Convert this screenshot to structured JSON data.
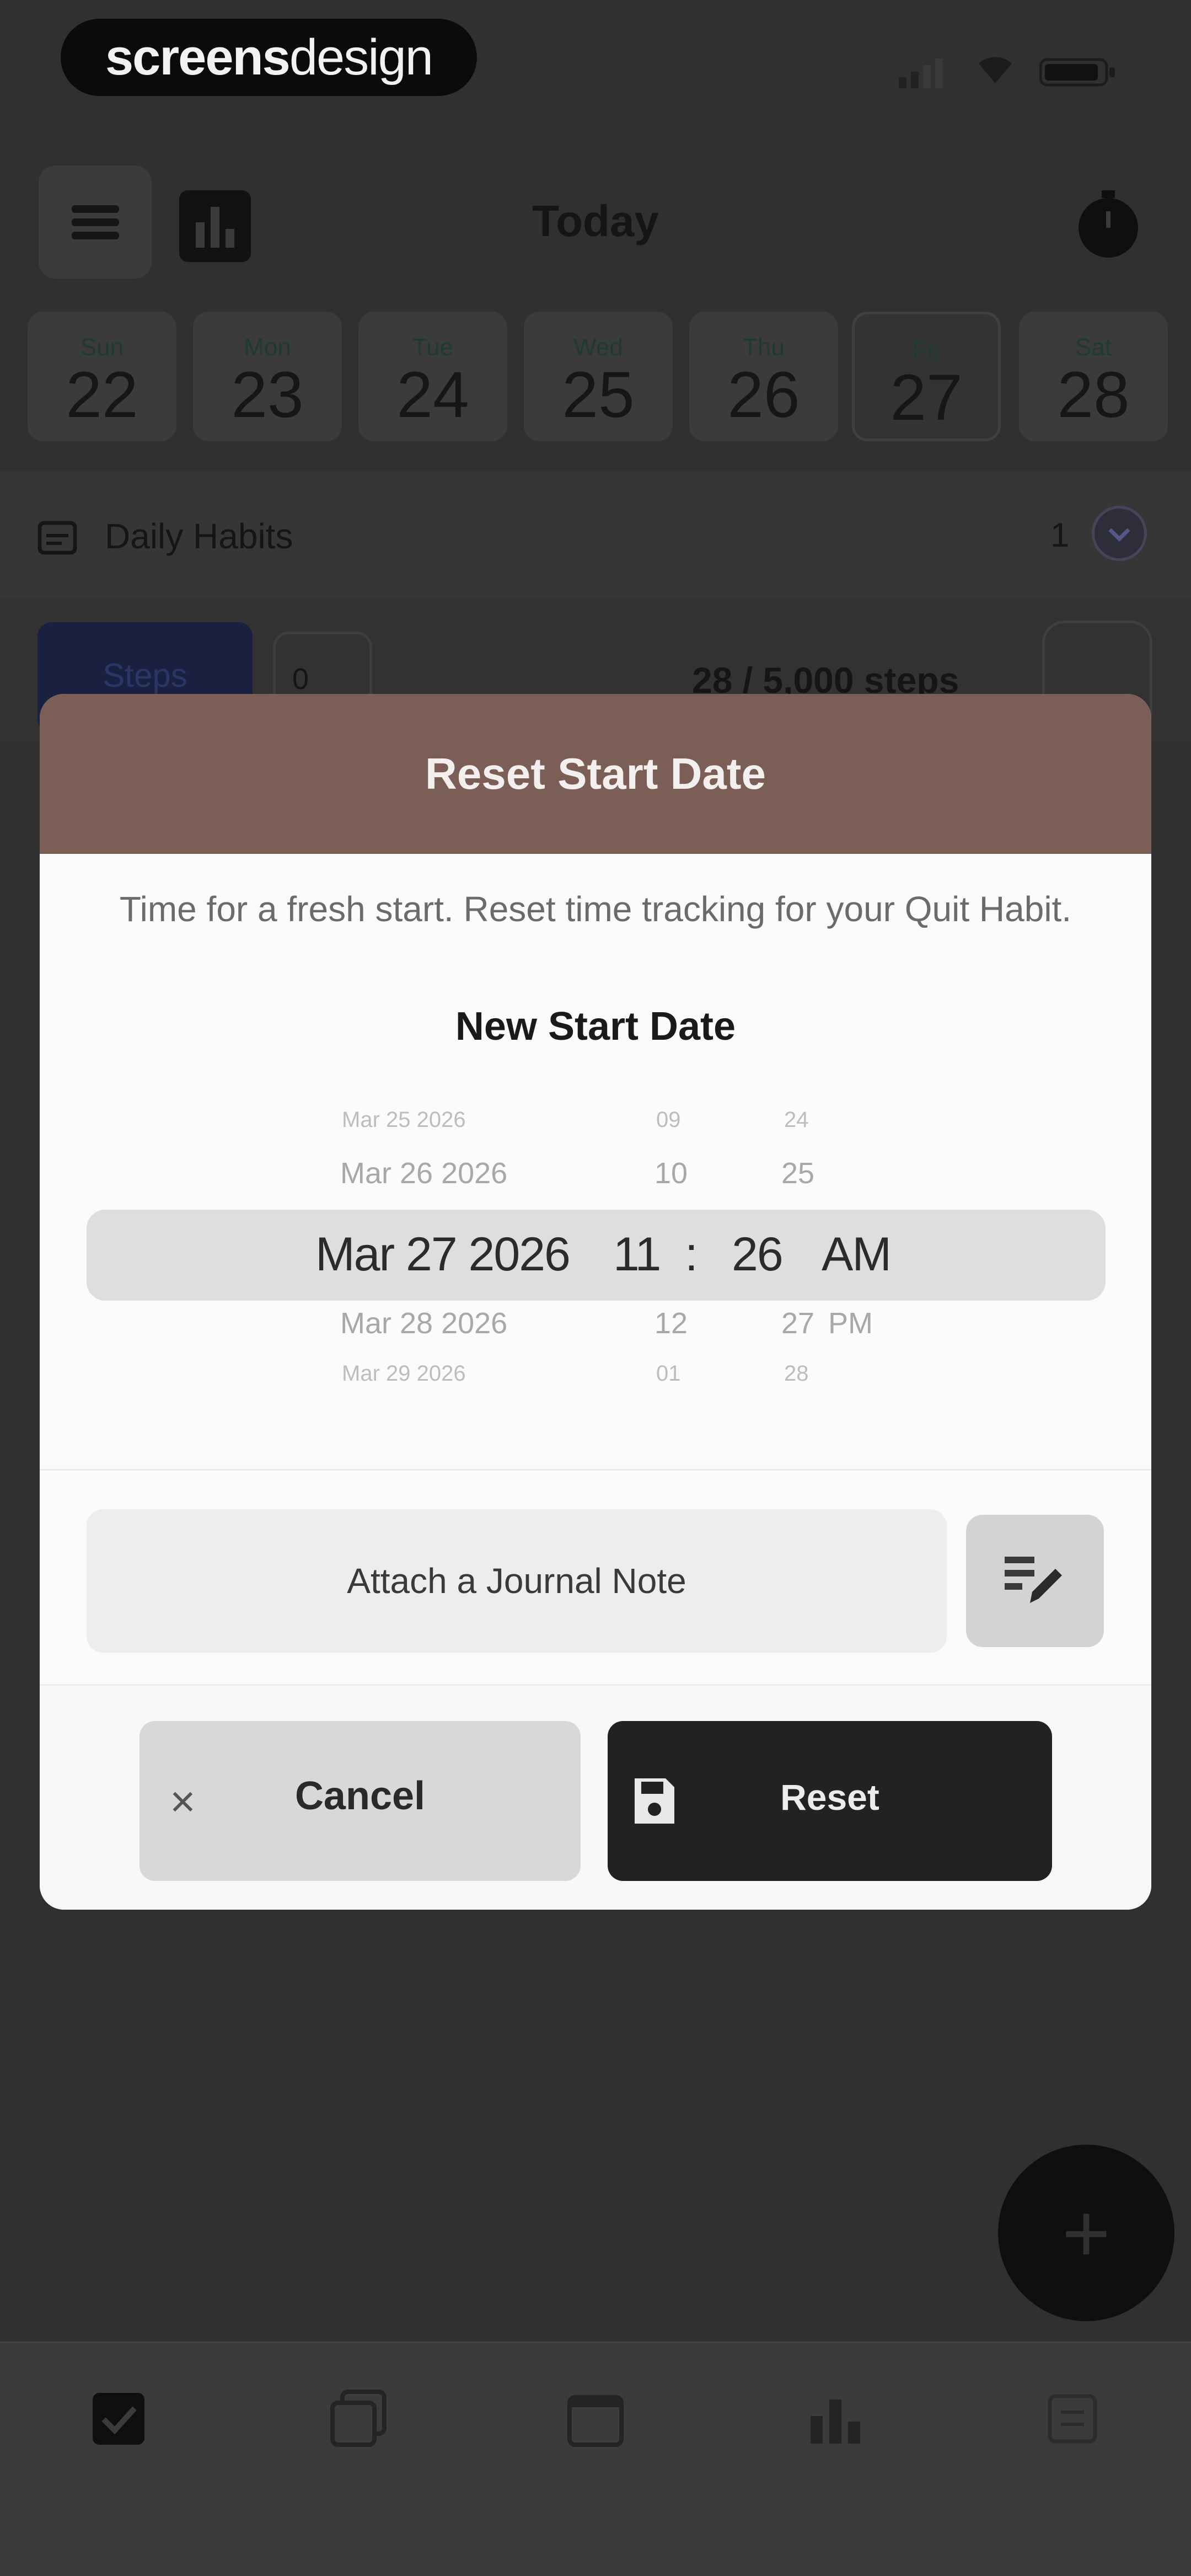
{
  "status_bar": {
    "brand_bold": "screens",
    "brand_light": "design"
  },
  "header": {
    "title": "Today"
  },
  "days": [
    {
      "name": "Sun",
      "num": "22"
    },
    {
      "name": "Mon",
      "num": "23"
    },
    {
      "name": "Tue",
      "num": "24"
    },
    {
      "name": "Wed",
      "num": "25"
    },
    {
      "name": "Thu",
      "num": "26"
    },
    {
      "name": "Fri",
      "num": "27",
      "selected": true
    },
    {
      "name": "Sat",
      "num": "28"
    }
  ],
  "section": {
    "title": "Daily Habits",
    "count": "1"
  },
  "habit": {
    "tag": "Steps",
    "zero": "0",
    "progress": "28 / 5,000 steps"
  },
  "modal": {
    "title": "Reset Start Date",
    "description": "Time for a fresh start. Reset time tracking for your Quit Habit.",
    "subtitle": "New Start Date",
    "picker": {
      "selected": {
        "date": "Mar 27 2026",
        "hour": "11",
        "sep": ":",
        "minute": "26",
        "ampm": "AM"
      },
      "above1": {
        "date": "Mar 26 2026",
        "hour": "10",
        "minute": "25"
      },
      "above2": {
        "date": "Mar 25 2026",
        "hour": "09",
        "minute": "24"
      },
      "below1": {
        "date": "Mar 28 2026",
        "hour": "12",
        "minute": "27",
        "ampm": "PM"
      },
      "below2": {
        "date": "Mar 29 2026",
        "hour": "01",
        "minute": "28"
      }
    },
    "journal_label": "Attach a Journal Note",
    "cancel_label": "Cancel",
    "cancel_icon": "×",
    "reset_label": "Reset"
  },
  "fab": {
    "icon": "+"
  }
}
